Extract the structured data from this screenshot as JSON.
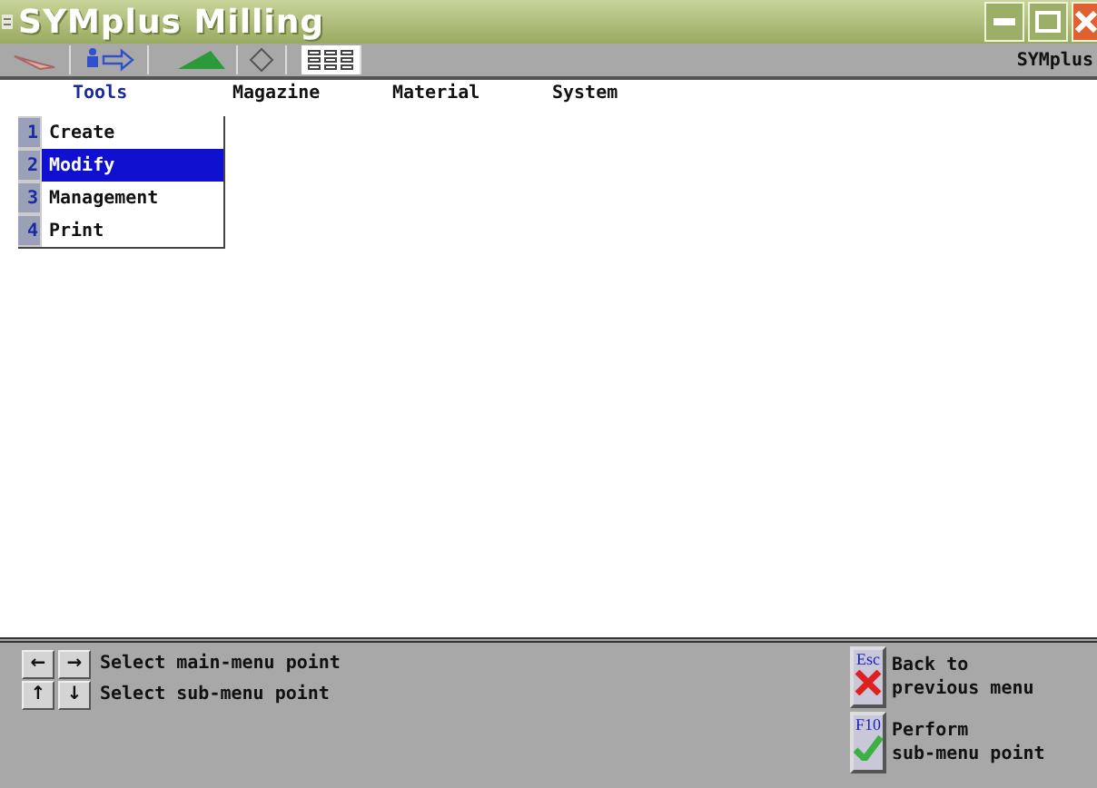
{
  "window": {
    "title": "SYMplus Milling"
  },
  "toolbar": {
    "label": "SYMplus"
  },
  "menu": [
    {
      "label": "Tools",
      "selected": true
    },
    {
      "label": "Magazine",
      "selected": false
    },
    {
      "label": "Material",
      "selected": false
    },
    {
      "label": "System",
      "selected": false
    }
  ],
  "submenu": [
    {
      "key": "1",
      "label": "Create",
      "selected": false
    },
    {
      "key": "2",
      "label": "Modify",
      "selected": true
    },
    {
      "key": "3",
      "label": "Management",
      "selected": false
    },
    {
      "key": "4",
      "label": "Print",
      "selected": false
    }
  ],
  "hints": [
    {
      "keys": [
        "←",
        "→"
      ],
      "text": "Select main-menu point"
    },
    {
      "keys": [
        "↑",
        "↓"
      ],
      "text": "Select sub-menu point"
    }
  ],
  "actions": [
    {
      "key": "Esc",
      "kind": "cancel",
      "lines": [
        "Back to",
        "previous menu"
      ]
    },
    {
      "key": "F10",
      "kind": "confirm",
      "lines": [
        "Perform",
        "sub-menu point"
      ]
    }
  ]
}
